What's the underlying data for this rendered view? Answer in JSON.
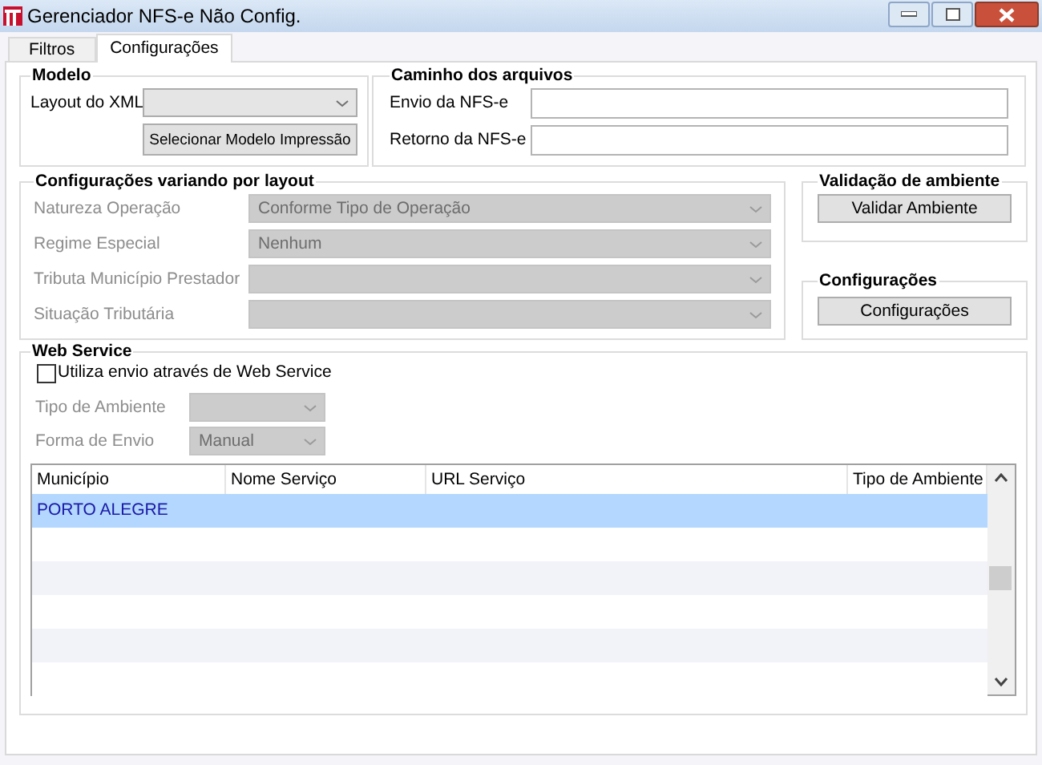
{
  "window": {
    "title": "Gerenciador NFS-e Não Config."
  },
  "tabs": [
    {
      "label": "Filtros",
      "selected": false
    },
    {
      "label": "Configurações",
      "selected": true
    }
  ],
  "modelo": {
    "title": "Modelo",
    "layout_label": "Layout do XML",
    "button": "Selecionar Modelo Impressão"
  },
  "caminho": {
    "title": "Caminho dos arquivos",
    "fields": [
      {
        "label": "Envio da NFS-e"
      },
      {
        "label": "Retorno da NFS-e"
      }
    ]
  },
  "layout_config": {
    "title": "Configurações variando por layout",
    "disabled": true,
    "fields": [
      {
        "label": "Natureza Operação",
        "value": "Conforme Tipo de Operação"
      },
      {
        "label": "Regime Especial",
        "value": "Nenhum"
      },
      {
        "label": "Tributa Município Prestador"
      },
      {
        "label": "Situação Tributária"
      }
    ]
  },
  "validacao": {
    "title": "Validação de ambiente",
    "button": "Validar Ambiente"
  },
  "configuracoes": {
    "title": "Configurações",
    "button": "Configurações"
  },
  "web_service": {
    "title": "Web Service",
    "checkbox": {
      "label": "Utiliza envio através de Web Service",
      "checked": false
    },
    "fields": [
      {
        "label": "Tipo de Ambiente",
        "disabled": true
      },
      {
        "label": "Forma de Envio",
        "value": "Manual",
        "disabled": true
      }
    ],
    "table": {
      "columns": [
        "Município",
        "Nome Serviço",
        "URL Serviço",
        "Tipo de Ambiente"
      ],
      "rows": [
        {
          "cells": [
            "PORTO ALEGRE"
          ],
          "selected": true
        }
      ]
    }
  }
}
